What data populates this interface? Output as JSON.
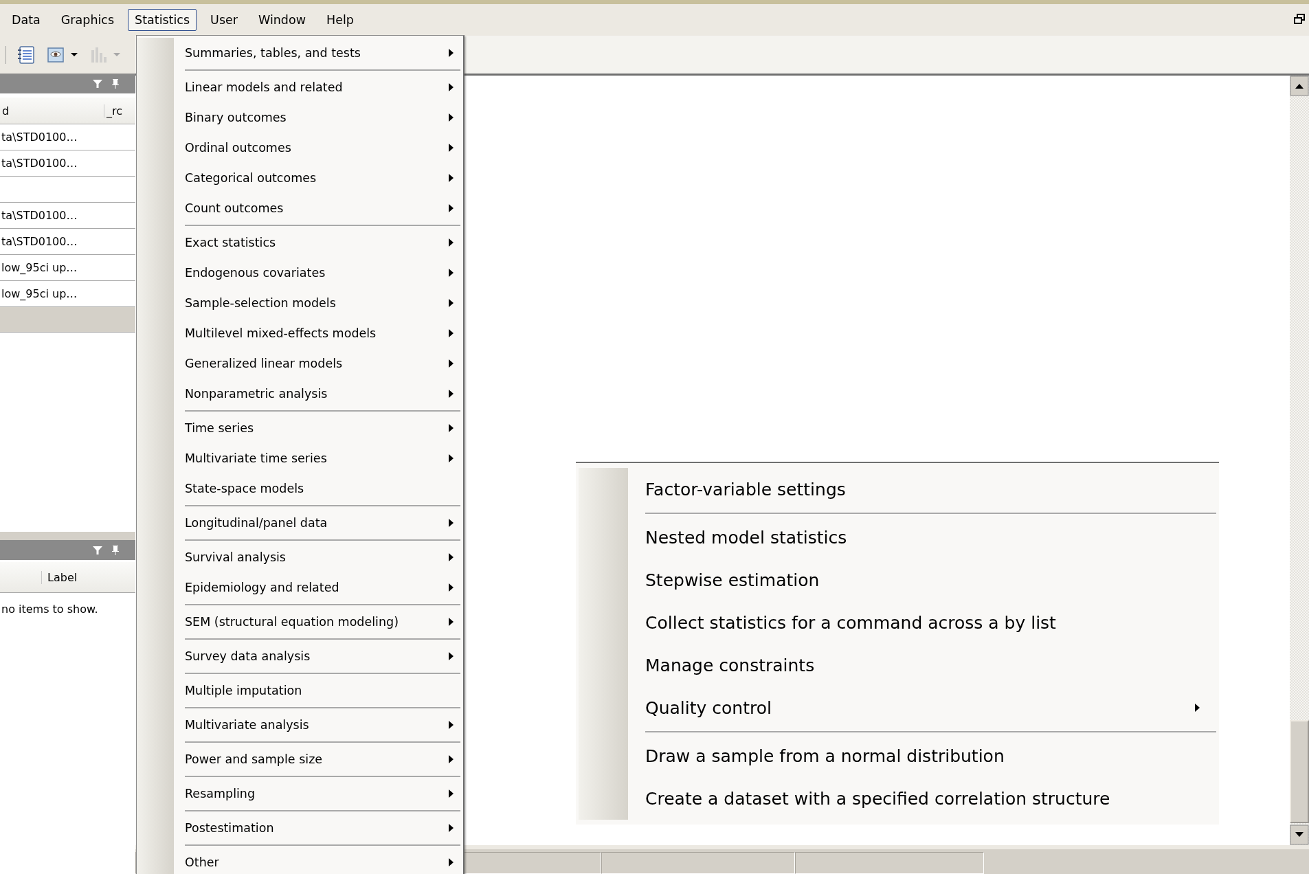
{
  "menubar": {
    "items": [
      {
        "label": "Data",
        "selected": false
      },
      {
        "label": "Graphics",
        "selected": false
      },
      {
        "label": "Statistics",
        "selected": true
      },
      {
        "label": "User",
        "selected": false
      },
      {
        "label": "Window",
        "selected": false
      },
      {
        "label": "Help",
        "selected": false
      }
    ]
  },
  "toolbar": {
    "buttons": [
      {
        "kind": "notebook",
        "disabled": false,
        "dropdown": false
      },
      {
        "kind": "viewer",
        "disabled": false,
        "dropdown": true
      },
      {
        "kind": "chart",
        "disabled": true,
        "dropdown": true
      }
    ]
  },
  "variables_panel": {
    "columns": [
      "d",
      "_rc"
    ],
    "rows": [
      {
        "kind": "text",
        "text": "ta\\STD0100…"
      },
      {
        "kind": "text",
        "text": "ta\\STD0100…"
      },
      {
        "kind": "blank"
      },
      {
        "kind": "text",
        "text": "ta\\STD0100…"
      },
      {
        "kind": "text",
        "text": "ta\\STD0100…"
      },
      {
        "kind": "text",
        "text": "low_95ci up…"
      },
      {
        "kind": "text",
        "text": "low_95ci up…"
      }
    ]
  },
  "properties_panel": {
    "columns": [
      "Label"
    ],
    "message": "no items to show."
  },
  "statistics_menu": {
    "groups": [
      {
        "items": [
          {
            "label": "Summaries, tables, and tests",
            "submenu": true
          }
        ]
      },
      {
        "items": [
          {
            "label": "Linear models and related",
            "submenu": true
          },
          {
            "label": "Binary outcomes",
            "submenu": true
          },
          {
            "label": "Ordinal outcomes",
            "submenu": true
          },
          {
            "label": "Categorical outcomes",
            "submenu": true
          },
          {
            "label": "Count outcomes",
            "submenu": true
          }
        ]
      },
      {
        "items": [
          {
            "label": "Exact statistics",
            "submenu": true
          },
          {
            "label": "Endogenous covariates",
            "submenu": true
          },
          {
            "label": "Sample-selection models",
            "submenu": true
          },
          {
            "label": "Multilevel mixed-effects models",
            "submenu": true
          },
          {
            "label": "Generalized linear models",
            "submenu": true
          },
          {
            "label": "Nonparametric analysis",
            "submenu": true
          }
        ]
      },
      {
        "items": [
          {
            "label": "Time series",
            "submenu": true
          },
          {
            "label": "Multivariate time series",
            "submenu": true
          },
          {
            "label": "State-space models",
            "submenu": false
          }
        ]
      },
      {
        "items": [
          {
            "label": "Longitudinal/panel data",
            "submenu": true
          }
        ]
      },
      {
        "items": [
          {
            "label": "Survival analysis",
            "submenu": true
          },
          {
            "label": "Epidemiology and related",
            "submenu": true
          }
        ]
      },
      {
        "items": [
          {
            "label": "SEM (structural equation modeling)",
            "submenu": true
          }
        ]
      },
      {
        "items": [
          {
            "label": "Survey data analysis",
            "submenu": true
          }
        ]
      },
      {
        "items": [
          {
            "label": "Multiple imputation",
            "submenu": false
          }
        ]
      },
      {
        "items": [
          {
            "label": "Multivariate analysis",
            "submenu": true
          }
        ]
      },
      {
        "items": [
          {
            "label": "Power and sample size",
            "submenu": true
          }
        ]
      },
      {
        "items": [
          {
            "label": "Resampling",
            "submenu": true
          }
        ]
      },
      {
        "items": [
          {
            "label": "Postestimation",
            "submenu": true
          }
        ]
      },
      {
        "items": [
          {
            "label": "Other",
            "submenu": true
          }
        ]
      }
    ]
  },
  "other_submenu": {
    "groups": [
      {
        "items": [
          {
            "label": "Factor-variable settings",
            "submenu": false
          }
        ]
      },
      {
        "items": [
          {
            "label": "Nested model statistics",
            "submenu": false
          },
          {
            "label": "Stepwise estimation",
            "submenu": false
          },
          {
            "label": "Collect statistics for a command across a by list",
            "submenu": false
          },
          {
            "label": "Manage constraints",
            "submenu": false
          },
          {
            "label": "Quality control",
            "submenu": true
          }
        ]
      },
      {
        "items": [
          {
            "label": "Draw a sample from a normal distribution",
            "submenu": false
          },
          {
            "label": "Create a dataset with a specified correlation structure",
            "submenu": false
          }
        ]
      }
    ]
  }
}
